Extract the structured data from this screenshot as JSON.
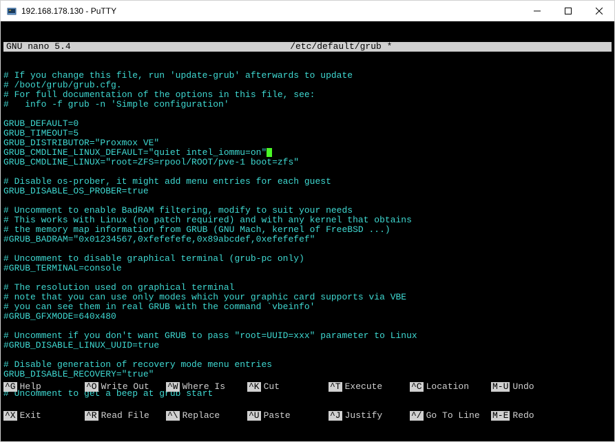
{
  "window": {
    "title": "192.168.178.130 - PuTTY"
  },
  "editor": {
    "name": "GNU nano 5.4",
    "filename": "/etc/default/grub *"
  },
  "lines": [
    {
      "type": "comment",
      "text": "# If you change this file, run 'update-grub' afterwards to update"
    },
    {
      "type": "comment",
      "text": "# /boot/grub/grub.cfg."
    },
    {
      "type": "comment",
      "text": "# For full documentation of the options in this file, see:"
    },
    {
      "type": "comment",
      "text": "#   info -f grub -n 'Simple configuration'"
    },
    {
      "type": "blank",
      "text": ""
    },
    {
      "type": "setting",
      "text": "GRUB_DEFAULT=0"
    },
    {
      "type": "setting",
      "text": "GRUB_TIMEOUT=5"
    },
    {
      "type": "setting",
      "text": "GRUB_DISTRIBUTOR=\"Proxmox VE\""
    },
    {
      "type": "setting",
      "text": "GRUB_CMDLINE_LINUX_DEFAULT=\"quiet intel_iommu=on\"",
      "cursor": true
    },
    {
      "type": "setting",
      "text": "GRUB_CMDLINE_LINUX=\"root=ZFS=rpool/ROOT/pve-1 boot=zfs\""
    },
    {
      "type": "blank",
      "text": ""
    },
    {
      "type": "comment",
      "text": "# Disable os-prober, it might add menu entries for each guest"
    },
    {
      "type": "setting",
      "text": "GRUB_DISABLE_OS_PROBER=true"
    },
    {
      "type": "blank",
      "text": ""
    },
    {
      "type": "comment",
      "text": "# Uncomment to enable BadRAM filtering, modify to suit your needs"
    },
    {
      "type": "comment",
      "text": "# This works with Linux (no patch required) and with any kernel that obtains"
    },
    {
      "type": "comment",
      "text": "# the memory map information from GRUB (GNU Mach, kernel of FreeBSD ...)"
    },
    {
      "type": "setting",
      "text": "#GRUB_BADRAM=\"0x01234567,0xfefefefe,0x89abcdef,0xefefefef\""
    },
    {
      "type": "blank",
      "text": ""
    },
    {
      "type": "comment",
      "text": "# Uncomment to disable graphical terminal (grub-pc only)"
    },
    {
      "type": "setting",
      "text": "#GRUB_TERMINAL=console"
    },
    {
      "type": "blank",
      "text": ""
    },
    {
      "type": "comment",
      "text": "# The resolution used on graphical terminal"
    },
    {
      "type": "comment",
      "text": "# note that you can use only modes which your graphic card supports via VBE"
    },
    {
      "type": "comment",
      "text": "# you can see them in real GRUB with the command `vbeinfo'"
    },
    {
      "type": "setting",
      "text": "#GRUB_GFXMODE=640x480"
    },
    {
      "type": "blank",
      "text": ""
    },
    {
      "type": "comment",
      "text": "# Uncomment if you don't want GRUB to pass \"root=UUID=xxx\" parameter to Linux"
    },
    {
      "type": "setting",
      "text": "#GRUB_DISABLE_LINUX_UUID=true"
    },
    {
      "type": "blank",
      "text": ""
    },
    {
      "type": "comment",
      "text": "# Disable generation of recovery mode menu entries"
    },
    {
      "type": "setting",
      "text": "GRUB_DISABLE_RECOVERY=\"true\""
    },
    {
      "type": "blank",
      "text": ""
    },
    {
      "type": "comment",
      "text": "# Uncomment to get a beep at grub start"
    }
  ],
  "shortcuts": {
    "row1": [
      {
        "key": "^G",
        "label": "Help"
      },
      {
        "key": "^O",
        "label": "Write Out"
      },
      {
        "key": "^W",
        "label": "Where Is"
      },
      {
        "key": "^K",
        "label": "Cut"
      },
      {
        "key": "^T",
        "label": "Execute"
      },
      {
        "key": "^C",
        "label": "Location"
      },
      {
        "key": "M-U",
        "label": "Undo"
      }
    ],
    "row2": [
      {
        "key": "^X",
        "label": "Exit"
      },
      {
        "key": "^R",
        "label": "Read File"
      },
      {
        "key": "^\\",
        "label": "Replace"
      },
      {
        "key": "^U",
        "label": "Paste"
      },
      {
        "key": "^J",
        "label": "Justify"
      },
      {
        "key": "^/",
        "label": "Go To Line"
      },
      {
        "key": "M-E",
        "label": "Redo"
      }
    ]
  }
}
